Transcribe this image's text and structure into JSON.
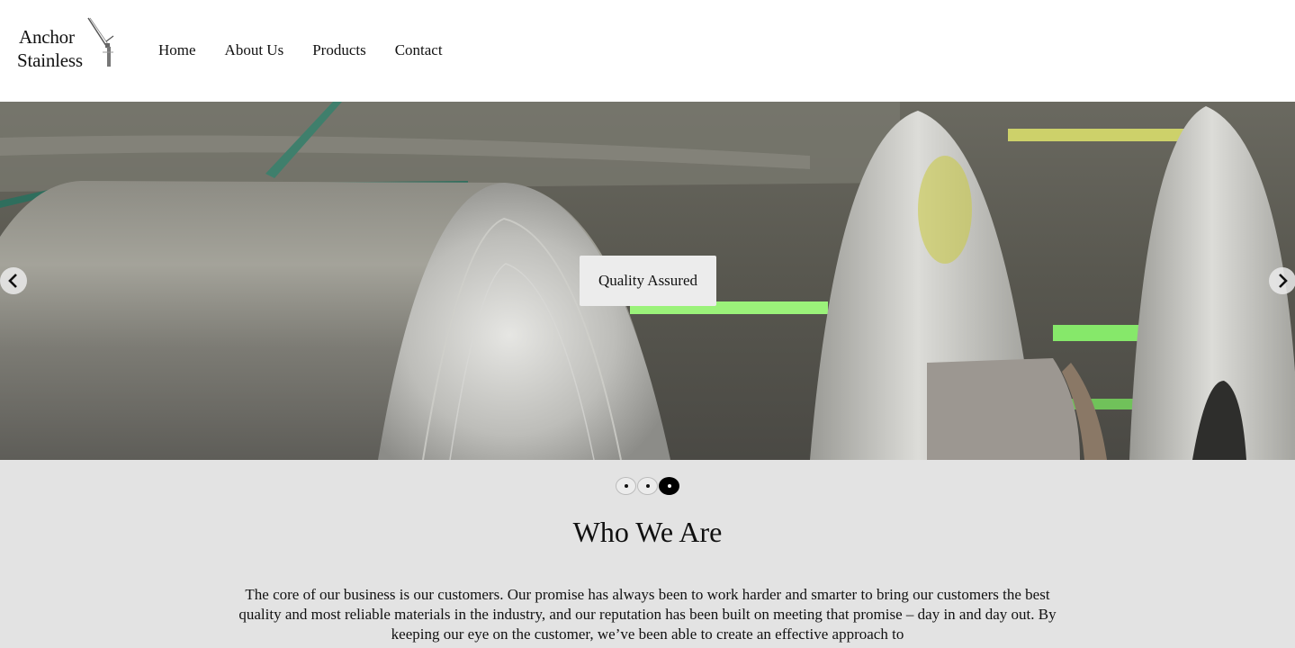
{
  "brand": {
    "line1": "Anchor",
    "line2": "Stainless"
  },
  "nav": {
    "items": [
      {
        "label": "Home"
      },
      {
        "label": "About Us"
      },
      {
        "label": "Products"
      },
      {
        "label": "Contact"
      }
    ]
  },
  "hero": {
    "caption": "Quality Assured",
    "prev_icon": "chevron-left-icon",
    "next_icon": "chevron-right-icon",
    "slide_count": 3,
    "active_slide": 3
  },
  "about": {
    "title": "Who We Are",
    "body": "The core of our business is our customers. Our promise has always been to work harder and smarter to bring our customers the best quality and most reliable materials in the industry, and our reputation has been built on meeting that promise – day in and day out. By keeping our eye on the customer, we’ve been able to create an effective approach to"
  },
  "colors": {
    "section_bg": "#e3e3e3",
    "caption_bg": "#ececec",
    "text": "#111111"
  }
}
